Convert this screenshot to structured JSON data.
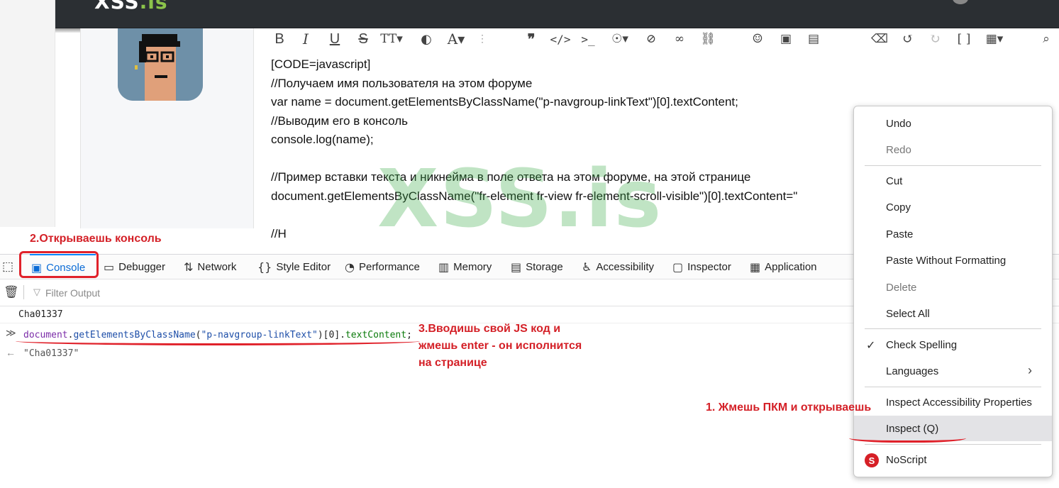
{
  "site": {
    "logo_main": "XSS",
    "logo_accent": ".is"
  },
  "editor": {
    "lines": [
      "[CODE=javascript]",
      "//Получаем имя пользователя на этом форуме",
      "var name = document.getElementsByClassName(\"p-navgroup-linkText\")[0].textContent;",
      "//Выводим его в консоль",
      "console.log(name);",
      "",
      "//Пример вставки текста и никнейма в поле ответа на этом форуме, на этой странице",
      "document.getElementsByClassName(\"fr-element fr-view fr-element-scroll-visible\")[0].textContent=\"",
      "",
      "//Н"
    ],
    "watermark": "XSS.is"
  },
  "annotations": {
    "step2": "2.Открываешь консоль",
    "step3": "3.Вводишь свой JS код и жмешь enter - он исполнится на странице",
    "step1": "1. Жмешь ПКМ и открываешь"
  },
  "devtools": {
    "tabs": [
      {
        "label": "Console",
        "icon": "console-icon"
      },
      {
        "label": "Debugger",
        "icon": "debugger-icon"
      },
      {
        "label": "Network",
        "icon": "network-icon"
      },
      {
        "label": "Style Editor",
        "icon": "style-editor-icon"
      },
      {
        "label": "Performance",
        "icon": "performance-icon"
      },
      {
        "label": "Memory",
        "icon": "memory-icon"
      },
      {
        "label": "Storage",
        "icon": "storage-icon"
      },
      {
        "label": "Accessibility",
        "icon": "accessibility-icon"
      },
      {
        "label": "Inspector",
        "icon": "inspector-icon"
      },
      {
        "label": "Application",
        "icon": "application-icon"
      }
    ],
    "filter_placeholder": "Filter Output",
    "log_output": "Cha01337",
    "command": {
      "obj": "document",
      "dot1": ".",
      "method": "getElementsByClassName",
      "open": "(",
      "arg": "\"p-navgroup-linkText\"",
      "close_idx": ")[0].",
      "prop": "textContent",
      "end": ";"
    },
    "result": "\"Cha01337\""
  },
  "context_menu": {
    "undo": "Undo",
    "redo": "Redo",
    "cut": "Cut",
    "copy": "Copy",
    "paste": "Paste",
    "paste_plain": "Paste Without Formatting",
    "delete": "Delete",
    "select_all": "Select All",
    "check_spelling": "Check Spelling",
    "languages": "Languages",
    "inspect_a11y": "Inspect Accessibility Properties",
    "inspect": "Inspect (Q)",
    "noscript": "NoScript"
  },
  "colors": {
    "annotation_red": "#d42027",
    "watermark_green": "#3caa46",
    "console_blue": "#0a84ff"
  }
}
